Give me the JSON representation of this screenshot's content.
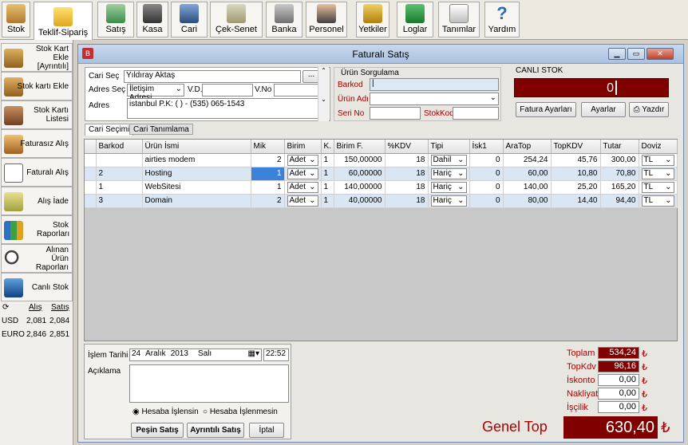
{
  "toolbar": {
    "items": [
      {
        "label": "Stok",
        "icon": "boxes-icon"
      },
      {
        "label": "Teklif-Sipariş",
        "icon": "folder-icon"
      },
      {
        "label": "Satış",
        "icon": "cart-icon"
      },
      {
        "label": "Kasa",
        "icon": "cash-register-icon"
      },
      {
        "label": "Cari",
        "icon": "people-icon"
      },
      {
        "label": "Çek-Senet",
        "icon": "documents-icon"
      },
      {
        "label": "Banka",
        "icon": "bank-icon"
      },
      {
        "label": "Personel",
        "icon": "person-icon"
      },
      {
        "label": "Yetkiler",
        "icon": "lock-icon"
      },
      {
        "label": "Loglar",
        "icon": "spreadsheet-icon"
      },
      {
        "label": "Tanımlar",
        "icon": "pen-icon"
      },
      {
        "label": "Yardım",
        "icon": "question-icon"
      }
    ]
  },
  "sidebar": {
    "items": [
      {
        "label": "Stok Kart Ekle [Ayrıntılı]"
      },
      {
        "label": "Stok kartı Ekle"
      },
      {
        "label": "Stok Kartı Listesi"
      },
      {
        "label": "Faturasız Alış"
      },
      {
        "label": "Faturalı Alış"
      },
      {
        "label": "Alış İade"
      },
      {
        "label": "Stok Raporları"
      },
      {
        "label": "Alınan Ürün Raporları"
      },
      {
        "label": "Canlı Stok"
      }
    ],
    "rates": {
      "buy_header": "Alış",
      "sell_header": "Satış",
      "rows": [
        {
          "cur": "USD",
          "buy": "2,081",
          "sell": "2,084"
        },
        {
          "cur": "EURO",
          "buy": "2,846",
          "sell": "2,851"
        }
      ]
    }
  },
  "window": {
    "title": "Faturalı Satış",
    "cari": {
      "cari_sec_label": "Cari Seç",
      "cari_value": "Yıldıray Aktaş",
      "dots": "...",
      "adres_sec_label": "Adres Seç",
      "adres_sec_value": "İletişim Adresi",
      "vd_label": "V.D.",
      "vno_label": "V.No",
      "adres_label": "Adres",
      "adres_value": "istanbul  P.K: (  )   - (535) 065-1543"
    },
    "tabs": [
      "Cari Seçimi",
      "Cari Tanımlama"
    ],
    "urun": {
      "title": "Ürün Sorgulama",
      "barkod_label": "Barkod",
      "urun_adi_label": "Ürün Adı",
      "seri_no_label": "Seri No",
      "stok_kod_label": "StokKod"
    },
    "canli": {
      "title": "CANLI STOK",
      "value": "0",
      "fatura_ayarlari": "Fatura Ayarları",
      "ayarlar": "Ayarlar",
      "yazdir": "Yazdır"
    },
    "grid": {
      "headers": [
        "Barkod",
        "Ürün İsmi",
        "Mik",
        "Birim",
        "K.",
        "Birim F.",
        "%KDV",
        "Tipi",
        "İsk1",
        "AraTop",
        "TopKDV",
        "Tutar",
        "Doviz"
      ],
      "rows": [
        {
          "barkod": "",
          "urun": "airties modem",
          "mik": "2",
          "birim": "Adet",
          "k": "1",
          "birim_f": "150,00000",
          "kdv": "18",
          "tipi": "Dahil",
          "isk": "0",
          "aratop": "254,24",
          "topkdv": "45,76",
          "tutar": "300,00",
          "doviz": "TL"
        },
        {
          "barkod": "2",
          "urun": "Hosting",
          "mik": "1",
          "birim": "Adet",
          "k": "1",
          "birim_f": "60,00000",
          "kdv": "18",
          "tipi": "Hariç",
          "isk": "0",
          "aratop": "60,00",
          "topkdv": "10,80",
          "tutar": "70,80",
          "doviz": "TL"
        },
        {
          "barkod": "1",
          "urun": "WebSitesi",
          "mik": "1",
          "birim": "Adet",
          "k": "1",
          "birim_f": "140,00000",
          "kdv": "18",
          "tipi": "Hariç",
          "isk": "0",
          "aratop": "140,00",
          "topkdv": "25,20",
          "tutar": "165,20",
          "doviz": "TL"
        },
        {
          "barkod": "3",
          "urun": "Domain",
          "mik": "2",
          "birim": "Adet",
          "k": "1",
          "birim_f": "40,00000",
          "kdv": "18",
          "tipi": "Hariç",
          "isk": "0",
          "aratop": "80,00",
          "topkdv": "14,40",
          "tutar": "94,40",
          "doviz": "TL"
        }
      ]
    },
    "footer": {
      "islem_tarihi_label": "İşlem Tarihi",
      "date_day": "24",
      "date_month": "Aralık",
      "date_year": "2013",
      "date_weekday": "Salı",
      "time": "22:52",
      "aciklama_label": "Açıklama",
      "radio1": "Hesaba İşlensin",
      "radio2": "Hesaba İşlenmesin",
      "pesin_satis": "Peşin Satış",
      "ayrintili_satis": "Ayrıntılı Satış",
      "iptal": "İptal"
    },
    "totals": {
      "toplam_label": "Toplam",
      "toplam": "534,24",
      "topkdv_label": "TopKdv",
      "topkdv": "96,16",
      "iskonto_label": "İskonto",
      "iskonto": "0,00",
      "nakliyat_label": "Nakliyat",
      "nakliyat": "0,00",
      "iscilik_label": "İşçilik",
      "iscilik": "0,00",
      "genel_label": "Genel Top",
      "genel": "630,40",
      "currency": "₺"
    }
  },
  "colors": {
    "accent_red": "#800000",
    "selected_row": "#dbe6f4",
    "title_blue": "#a9c1e0"
  }
}
